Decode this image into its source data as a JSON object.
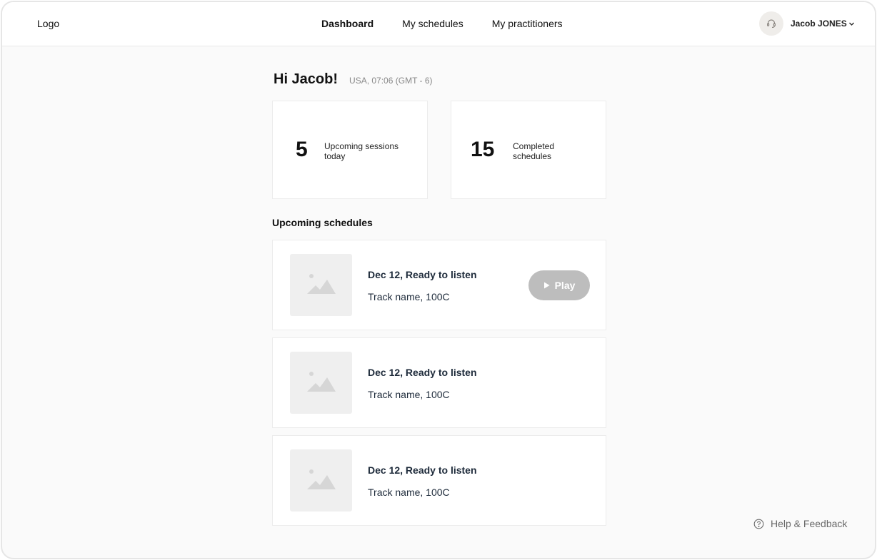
{
  "header": {
    "logo": "Logo",
    "nav": [
      {
        "label": "Dashboard",
        "active": true
      },
      {
        "label": "My schedules",
        "active": false
      },
      {
        "label": "My practitioners",
        "active": false
      }
    ],
    "support_icon": "headset-icon",
    "user_name": "Jacob JONES",
    "user_menu_icon": "chevron-down-icon"
  },
  "greeting": {
    "text": "Hi Jacob!",
    "locale": "USA, 07:06 (GMT - 6)"
  },
  "stats": [
    {
      "value": "5",
      "label": "Upcoming sessions today"
    },
    {
      "value": "15",
      "label": "Completed schedules"
    }
  ],
  "upcoming": {
    "title": "Upcoming schedules",
    "items": [
      {
        "title": "Dec 12, Ready to listen",
        "track": "Track name, 100C",
        "thumbnail_icon": "image-placeholder-icon",
        "play_label": "Play"
      },
      {
        "title": "Dec 12, Ready to listen",
        "track": "Track name, 100C",
        "thumbnail_icon": "image-placeholder-icon"
      },
      {
        "title": "Dec 12, Ready to listen",
        "track": "Track name, 100C",
        "thumbnail_icon": "image-placeholder-icon"
      }
    ]
  },
  "help": {
    "label": "Help & Feedback",
    "icon": "question-circle-icon"
  },
  "colors": {
    "background": "#fafafa",
    "card": "#ffffff",
    "play_button": "#bdbdbd",
    "text_dark": "#1d2a3a",
    "muted": "#888888"
  }
}
